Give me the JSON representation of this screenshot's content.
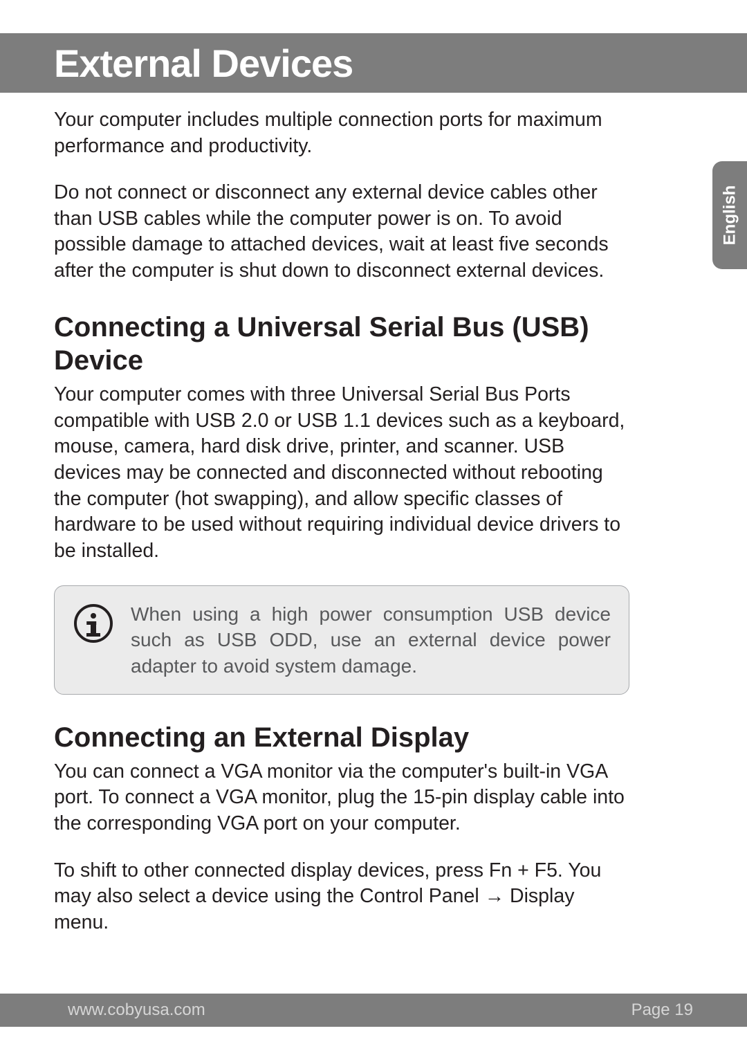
{
  "header": {
    "title": "External Devices"
  },
  "language_tab": "English",
  "body": {
    "para1": "Your computer includes multiple connection ports for maximum performance and productivity.",
    "para2": "Do not connect or disconnect any external device cables other than USB cables while the computer power is on. To avoid possible damage to attached devices, wait at least five seconds after the computer is shut down to disconnect external devices.",
    "h2_usb": "Connecting a Universal Serial Bus (USB) Device",
    "para3": "Your computer comes with three Universal Serial Bus Ports compatible with USB 2.0 or USB 1.1 devices such as a keyboard, mouse, camera, hard disk drive, printer, and scanner. USB devices may be connected and disconnected without rebooting the computer (hot swapping), and allow specific classes of hardware to be used without requiring individual device drivers to be installed.",
    "info_note": "When using a high power consumption USB device such as USB ODD, use an external device power adapter to avoid system damage.",
    "h2_display": "Connecting an External Display",
    "para4": "You can connect a VGA monitor via the computer's built-in VGA port. To connect a VGA monitor, plug the 15-pin display cable into the corresponding VGA port on your computer.",
    "para5_a": "To shift to other connected display devices, press Fn + F5. You may also select a device using the Control Panel ",
    "para5_arrow": "→",
    "para5_b": " Display menu."
  },
  "footer": {
    "url": "www.cobyusa.com",
    "page_label": "Page 19"
  }
}
